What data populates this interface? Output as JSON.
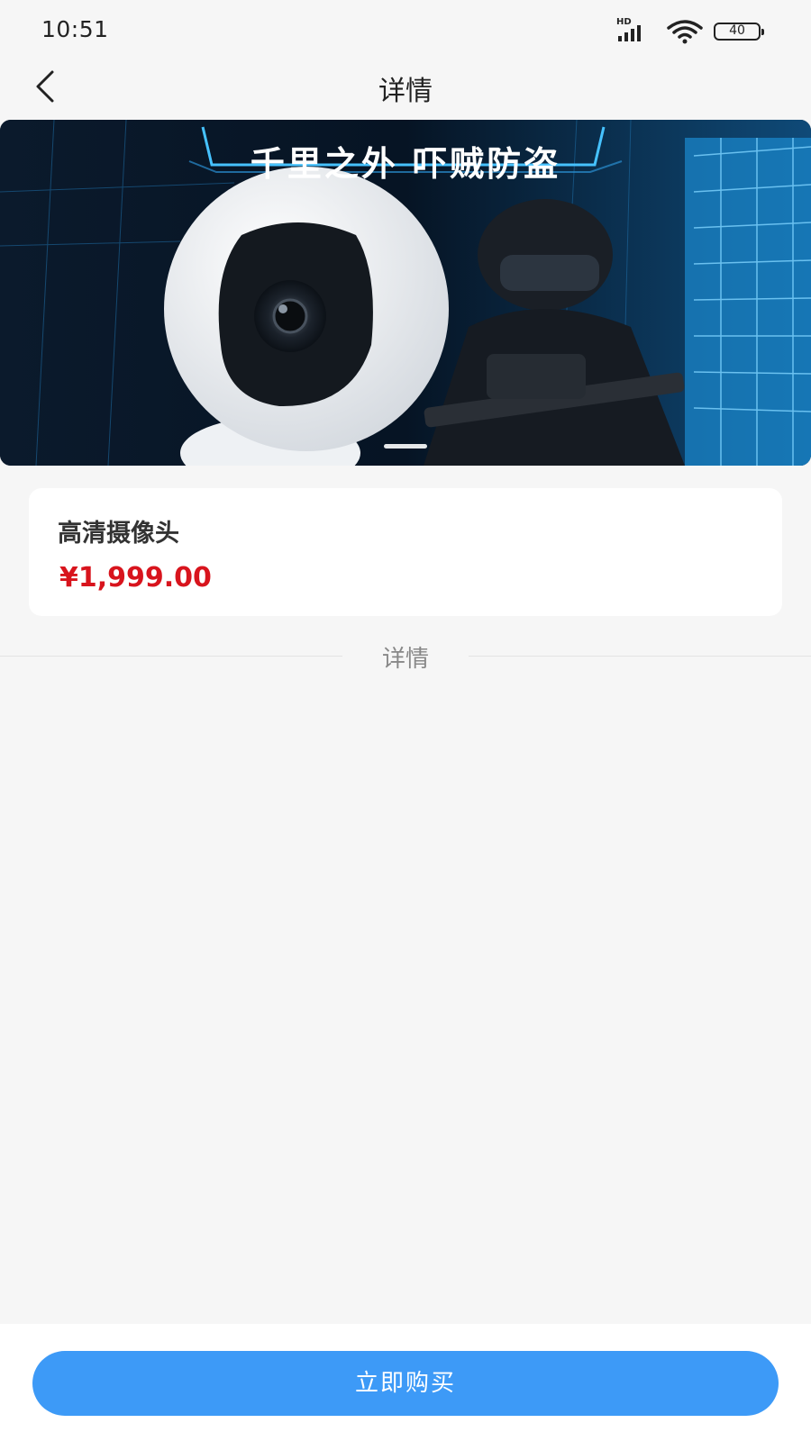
{
  "status_bar": {
    "time": "10:51",
    "battery": "40",
    "network_label": "HD",
    "icons": [
      "signal-icon",
      "wifi-icon",
      "battery-icon"
    ]
  },
  "nav": {
    "title": "详情",
    "back_icon": "chevron-left-icon"
  },
  "banner": {
    "headline": "千里之外  吓贼防盗"
  },
  "product": {
    "name": "高清摄像头",
    "price": "¥1,999.00"
  },
  "section": {
    "details_label": "详情"
  },
  "footer": {
    "buy_label": "立即购买"
  },
  "colors": {
    "accent": "#3d9af7",
    "price": "#d8141d",
    "background": "#f6f6f6"
  }
}
